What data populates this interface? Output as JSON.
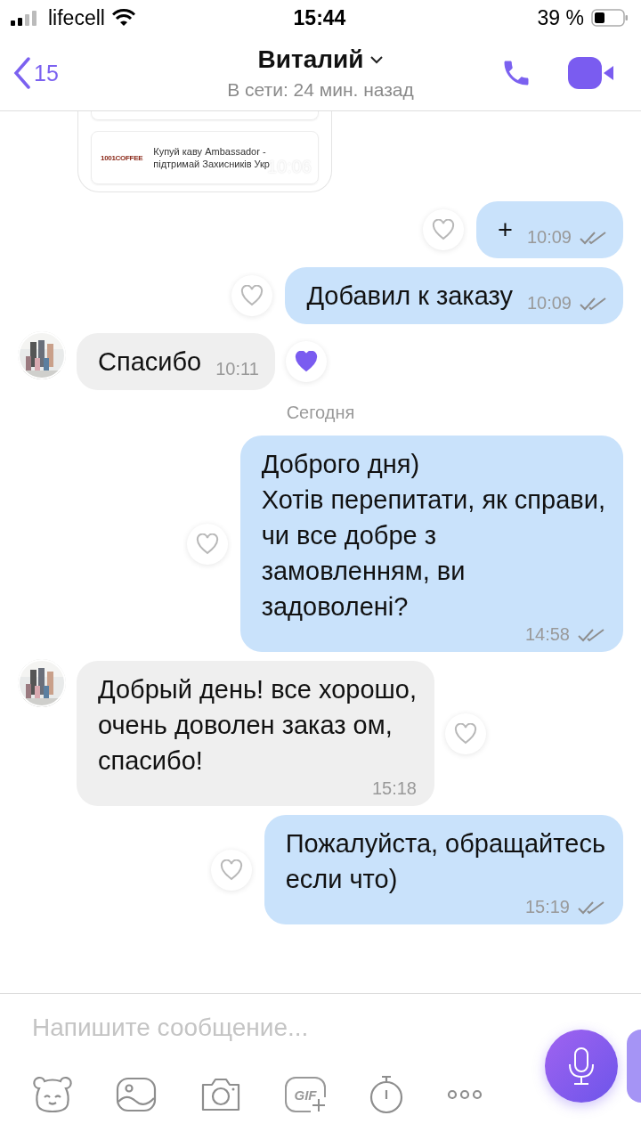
{
  "status_bar": {
    "carrier": "lifecell",
    "time": "15:44",
    "battery": "39 %"
  },
  "header": {
    "back_count": "15",
    "title": "Виталий",
    "subtitle": "В сети: 24 мин. назад"
  },
  "link_preview": {
    "brand": "1001COFFEE",
    "title": "Купуй каву Ambassador -",
    "subtitle": "підтримай Захисників Укр",
    "time": "10:06"
  },
  "messages": [
    {
      "kind": "out",
      "lines": [
        "+"
      ],
      "time": "10:09",
      "liked": false,
      "read": true
    },
    {
      "kind": "out",
      "lines": [
        "Добавил к заказу"
      ],
      "time": "10:09",
      "liked": false,
      "read": true
    },
    {
      "kind": "in",
      "lines": [
        "Спасибо"
      ],
      "time": "10:11",
      "liked": true
    },
    {
      "kind": "date",
      "lines": [
        "Сегодня"
      ]
    },
    {
      "kind": "out",
      "lines": [
        "Доброго дня)",
        "Хотів перепитати, як справи,",
        "чи все добре з",
        "замовленням, ви",
        "задоволені?"
      ],
      "time": "14:58",
      "liked": false,
      "read": true
    },
    {
      "kind": "in",
      "lines": [
        "Добрый день! все хорошо,",
        "очень доволен заказ ом,",
        "спасибо!"
      ],
      "time": "15:18",
      "liked": false
    },
    {
      "kind": "out",
      "lines": [
        "Пожалуйста, обращайтесь",
        "если что)"
      ],
      "time": "15:19",
      "liked": false,
      "read": true
    }
  ],
  "composer": {
    "placeholder": "Напишите сообщение...",
    "gif_label": "GIF"
  }
}
